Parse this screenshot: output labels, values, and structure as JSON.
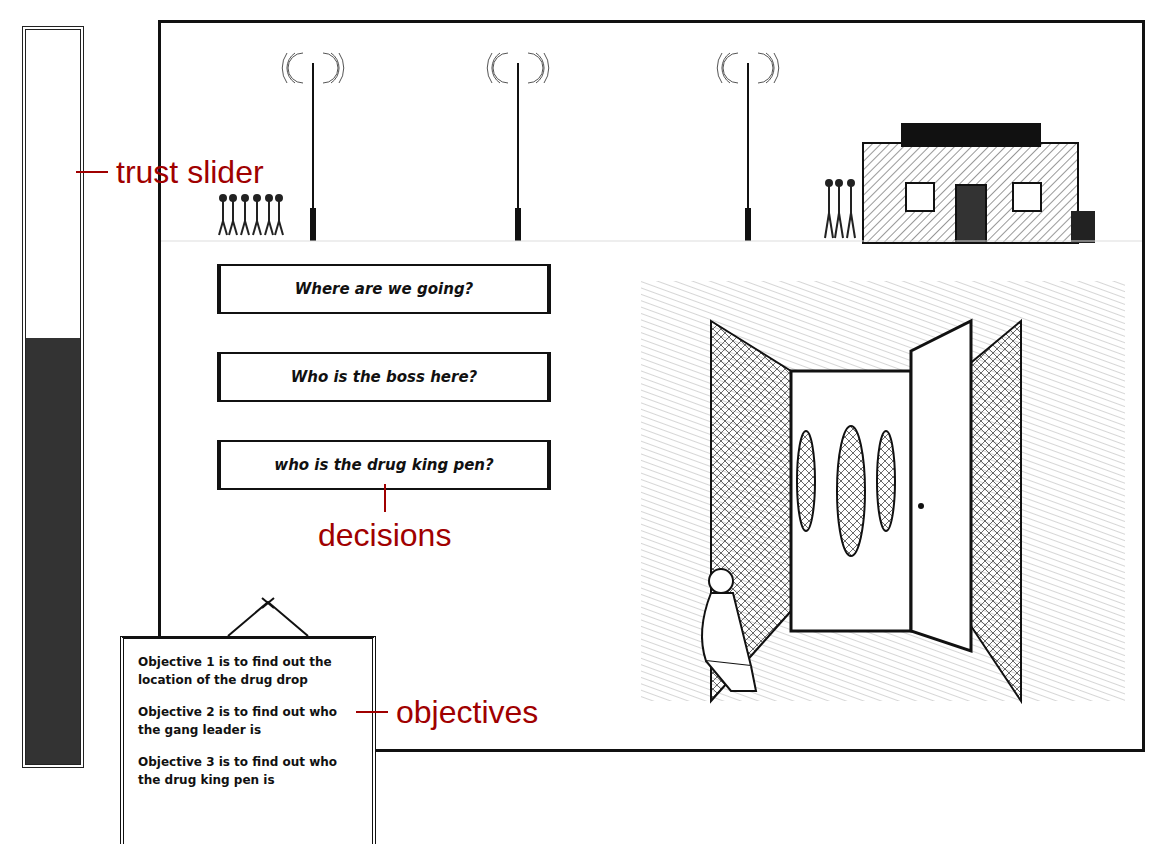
{
  "trust_slider": {
    "label": "trust slider",
    "level": 0.58
  },
  "decisions": {
    "label": "decisions",
    "items": [
      {
        "text": "Where are we going?"
      },
      {
        "text": "Who is the boss here?"
      },
      {
        "text": "who is the drug king pen?"
      }
    ]
  },
  "objectives": {
    "label": "objectives",
    "items": [
      {
        "text": "Objective 1 is to find out the location of the drug drop"
      },
      {
        "text": "Objective 2 is to find out who the gang leader is"
      },
      {
        "text": "Objective 3 is to find out who the drug king pen is"
      }
    ]
  }
}
